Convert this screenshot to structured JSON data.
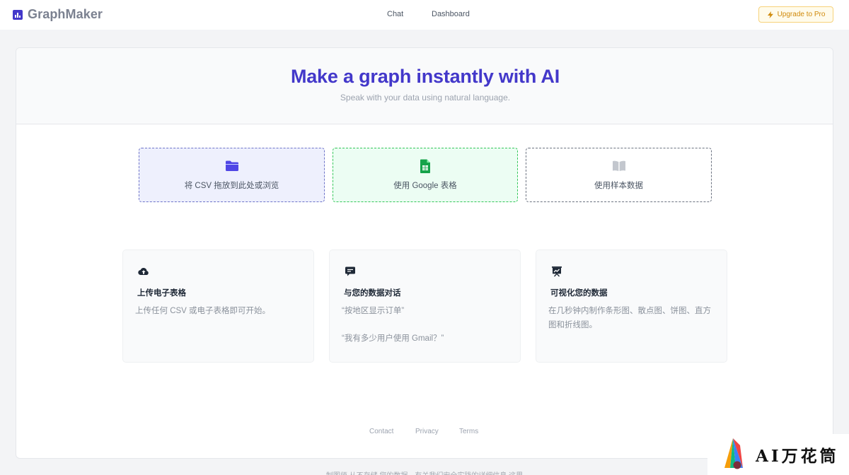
{
  "header": {
    "brand": "GraphMaker",
    "nav": {
      "chat": "Chat",
      "dashboard": "Dashboard"
    },
    "upgrade_label": "Upgrade to Pro"
  },
  "hero": {
    "title": "Make a graph instantly with AI",
    "subtitle": "Speak with your data using natural language."
  },
  "upload_options": {
    "csv": "将 CSV 拖放到此处或浏览",
    "google_sheets": "使用 Google 表格",
    "sample": "使用样本数据"
  },
  "features": [
    {
      "title": "上传电子表格",
      "lines": [
        "上传任何 CSV 或电子表格即可开始。"
      ]
    },
    {
      "title": "与您的数据对话",
      "lines": [
        "“按地区显示订单”",
        "“我有多少用户使用 Gmail？”"
      ]
    },
    {
      "title": "可视化您的数据",
      "lines": [
        "在几秒钟内制作条形图、散点图、饼图、直方图和折线图。"
      ]
    }
  ],
  "footer": {
    "contact": "Contact",
    "privacy": "Privacy",
    "terms": "Terms",
    "disclaimer": "制图师 从不存储 您的数据。有关我们安全实践的详细信息 这里"
  },
  "watermark": {
    "text": "AI万花筒"
  },
  "colors": {
    "accent": "#4338ca",
    "upgrade": "#d08a0b",
    "csv_border": "#6d73c8",
    "gsheet_border": "#34c759"
  },
  "icons": {
    "brand": "bar-chart-icon",
    "upgrade": "lightning-icon",
    "csv": "folder-icon",
    "google_sheets": "spreadsheet-icon",
    "sample": "book-icon",
    "feature_1": "cloud-upload-icon",
    "feature_2": "chat-bubble-icon",
    "feature_3": "presentation-chart-icon"
  }
}
